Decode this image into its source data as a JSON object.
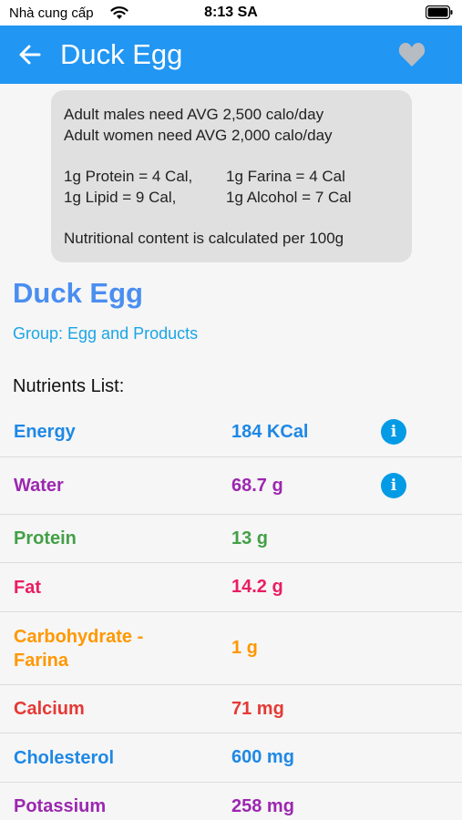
{
  "status_bar": {
    "carrier": "Nhà cung cấp",
    "time": "8:13 SA",
    "icons": [
      "wifi-icon",
      "battery-icon"
    ]
  },
  "app_bar": {
    "title": "Duck Egg",
    "back_icon": "arrow-left-icon",
    "favorite_icon": "heart-icon",
    "color": "#2196f3"
  },
  "info_box": {
    "line1": "Adult males need AVG 2,500 calo/day",
    "line2": "Adult women need AVG 2,000 calo/day",
    "protein": "1g Protein = 4 Cal,",
    "farina": "1g Farina = 4 Cal",
    "lipid": "1g Lipid = 9 Cal,",
    "alcohol": "1g Alcohol = 7 Cal",
    "note": "Nutritional content is calculated per 100g"
  },
  "food": {
    "name": "Duck Egg",
    "group": "Group: Egg and Products"
  },
  "nutrients_heading": "Nutrients List:",
  "nutrients": [
    {
      "name": "Energy",
      "value": "184 KCal",
      "color": "#1e88e5",
      "has_info": true
    },
    {
      "name": "Water",
      "value": "68.7 g",
      "color": "#9c27b0",
      "has_info": true
    },
    {
      "name": "Protein",
      "value": "13 g",
      "color": "#43a047",
      "has_info": false
    },
    {
      "name": "Fat",
      "value": "14.2 g",
      "color": "#e91e63",
      "has_info": false
    },
    {
      "name": "Carbohydrate -\nFarina",
      "value": "1 g",
      "color": "#ff9800",
      "has_info": false
    },
    {
      "name": "Calcium",
      "value": "71 mg",
      "color": "#e53935",
      "has_info": false
    },
    {
      "name": "Cholesterol",
      "value": "600 mg",
      "color": "#1e88e5",
      "has_info": false
    },
    {
      "name": "Potassium",
      "value": "258 mg",
      "color": "#9c27b0",
      "has_info": false
    }
  ]
}
